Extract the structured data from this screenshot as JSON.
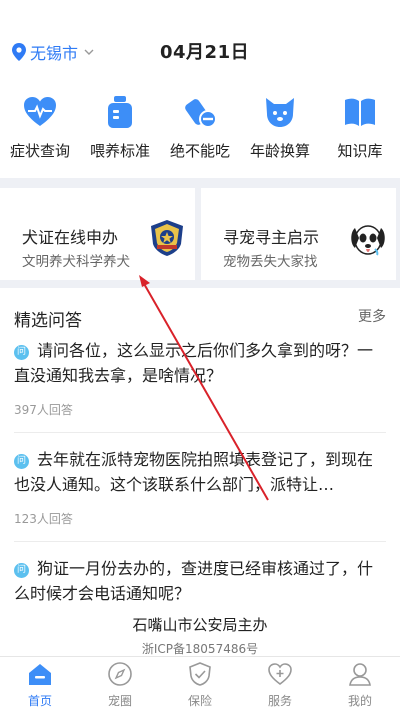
{
  "header": {
    "city": "无锡市",
    "date": "04月21日"
  },
  "quick_icons": [
    {
      "label": "症状查询",
      "icon": "heartbeat-icon"
    },
    {
      "label": "喂养标准",
      "icon": "food-bottle-icon"
    },
    {
      "label": "绝不能吃",
      "icon": "forbidden-food-icon"
    },
    {
      "label": "年龄换算",
      "icon": "dog-face-icon"
    },
    {
      "label": "知识库",
      "icon": "book-icon"
    }
  ],
  "cards": [
    {
      "title": "犬证在线申办",
      "subtitle": "文明养犬科学养犬",
      "icon": "police-badge-icon"
    },
    {
      "title": "寻宠寻主启示",
      "subtitle": "宠物丢失大家找",
      "icon": "dog-face-icon"
    }
  ],
  "qa": {
    "title": "精选问答",
    "more": "更多",
    "badge": "问",
    "items": [
      {
        "question": "请问各位，这么显示之后你们多久拿到的呀？一直没通知我去拿，是啥情况？",
        "count": "397人回答"
      },
      {
        "question": "去年就在派特宠物医院拍照填表登记了，到现在也没人通知。这个该联系什么部门，派特让…",
        "count": "123人回答"
      },
      {
        "question": "狗证一月份去办的，查进度已经审核通过了，什么时候才会电话通知呢？",
        "count": ""
      }
    ]
  },
  "footer": {
    "org": "石嘴山市公安局主办",
    "icp": "浙ICP备18057486号"
  },
  "tabs": [
    {
      "label": "首页",
      "icon": "home-icon",
      "active": true
    },
    {
      "label": "宠圈",
      "icon": "compass-icon",
      "active": false
    },
    {
      "label": "保险",
      "icon": "shield-check-icon",
      "active": false
    },
    {
      "label": "服务",
      "icon": "heart-plus-icon",
      "active": false
    },
    {
      "label": "我的",
      "icon": "user-icon",
      "active": false
    }
  ],
  "colors": {
    "accent": "#2f7bf5",
    "badge": "#5cc0ef",
    "annotation": "#d9222a"
  }
}
